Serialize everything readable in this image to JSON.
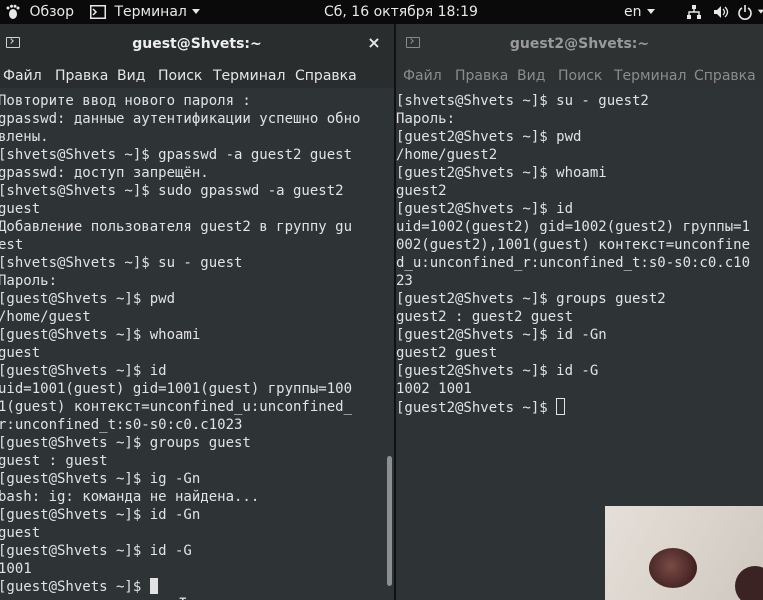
{
  "topbar": {
    "overview": "Обзор",
    "app_name": "Терминал",
    "datetime": "Сб, 16 октября  18:19",
    "lang": "en"
  },
  "left": {
    "title": "guest@Shvets:~",
    "close": "×",
    "menu": [
      "Файл",
      "Правка",
      "Вид",
      "Поиск",
      "Терминал",
      "Справка"
    ],
    "lines": [
      "Повторите ввод нового пароля :",
      "gpasswd: данные аутентификации успешно обно",
      "влены.",
      "[shvets@Shvets ~]$ gpasswd -a guest2 guest",
      "gpasswd: доступ запрещён.",
      "[shvets@Shvets ~]$ sudo gpasswd -a guest2",
      "guest",
      "Добавление пользователя guest2 в группу gu",
      "est",
      "[shvets@Shvets ~]$ su - guest",
      "Пароль:",
      "[guest@Shvets ~]$ pwd",
      "/home/guest",
      "[guest@Shvets ~]$ whoami",
      "guest",
      "[guest@Shvets ~]$ id",
      "uid=1001(guest) gid=1001(guest) группы=100",
      "1(guest) контекст=unconfined_u:unconfined_",
      "r:unconfined_t:s0-s0:c0.c1023",
      "[guest@Shvets ~]$ groups guest",
      "guest : guest",
      "[guest@Shvets ~]$ ig -Gn",
      "bash: ig: команда не найдена...",
      "[guest@Shvets ~]$ id -Gn",
      "guest",
      "[guest@Shvets ~]$ id -G",
      "1001",
      "[guest@Shvets ~]$ "
    ]
  },
  "right": {
    "title": "guest2@Shvets:~",
    "menu": [
      "Файл",
      "Правка",
      "Вид",
      "Поиск",
      "Терминал",
      "Справка"
    ],
    "lines": [
      "[shvets@Shvets ~]$ su - guest2",
      "Пароль:",
      "[guest2@Shvets ~]$ pwd",
      "/home/guest2",
      "[guest2@Shvets ~]$ whoami",
      "guest2",
      "[guest2@Shvets ~]$ id",
      "uid=1002(guest2) gid=1002(guest2) группы=1",
      "002(guest2),1001(guest) контекст=unconfine",
      "d_u:unconfined_r:unconfined_t:s0-s0:c0.c10",
      "23",
      "[guest2@Shvets ~]$ groups guest2",
      "guest2 : guest2 guest",
      "[guest2@Shvets ~]$ id -Gn",
      "guest2 guest",
      "[guest2@Shvets ~]$ id -G",
      "1002 1001",
      "[guest2@Shvets ~]$ "
    ]
  }
}
